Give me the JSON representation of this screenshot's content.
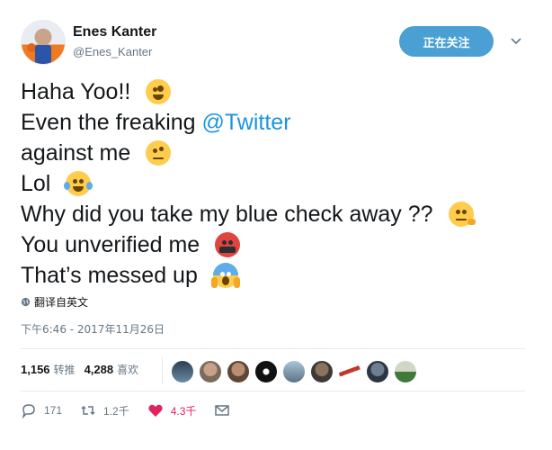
{
  "user": {
    "name": "Enes Kanter",
    "handle": "@Enes_Kanter",
    "follow_label": "正在关注"
  },
  "tweet": {
    "lines": [
      {
        "text": "Haha Yoo!! ",
        "emoji": "zany-face-emoji"
      },
      {
        "prefix": "Even the freaking ",
        "mention": "@Twitter"
      },
      {
        "text": "against me ",
        "emoji": "raised-eyebrow-face-emoji"
      },
      {
        "text": "Lol ",
        "emoji": "tears-of-joy-emoji"
      },
      {
        "text": "Why did you take my blue check away ?? ",
        "emoji": "thinking-face-emoji"
      },
      {
        "text": "You unverified me ",
        "emoji": "cursing-face-emoji"
      },
      {
        "text": "That’s messed up ",
        "emoji": "screaming-face-emoji"
      }
    ],
    "translate_label": "翻译自英文",
    "timestamp": "下午6:46 - 2017年11月26日"
  },
  "stats": {
    "retweets_count": "1,156",
    "retweets_label": "转推",
    "likes_count": "4,288",
    "likes_label": "喜欢"
  },
  "actions": {
    "reply_count": "171",
    "retweet_count": "1.2千",
    "like_count": "4.3千"
  },
  "colors": {
    "accent": "#4aa0d2",
    "link": "#1b95e0",
    "like": "#e0245e",
    "muted": "#657786"
  }
}
